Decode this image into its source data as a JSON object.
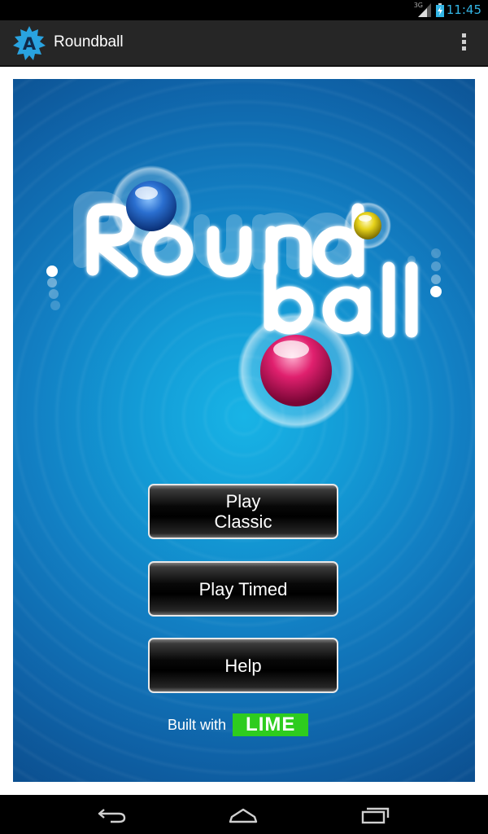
{
  "status_bar": {
    "network": "3G",
    "time": "11:45"
  },
  "action_bar": {
    "app_icon_letter": "A",
    "title": "Roundball",
    "overflow_icon": "overflow-menu-icon"
  },
  "game": {
    "logo_text_line1": "Round",
    "logo_text_line2": "ball",
    "buttons": {
      "play_classic": "Play Classic",
      "play_timed": "Play Timed",
      "help": "Help"
    },
    "built_with": "Built with",
    "engine": "LIME"
  },
  "nav_bar": {
    "icons": [
      "back-icon",
      "home-icon",
      "recent-apps-icon"
    ]
  },
  "colors": {
    "accent_blue": "#33b5e5",
    "ball_blue": "#2a6fd0",
    "ball_yellow": "#e6d21a",
    "ball_pink": "#e0206e",
    "lime_green": "#2ecc1e"
  }
}
